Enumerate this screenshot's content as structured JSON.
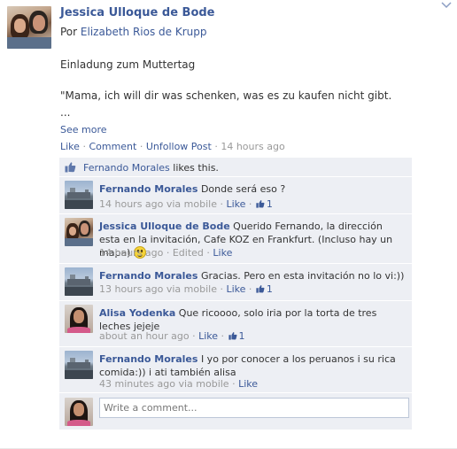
{
  "post": {
    "author": "Jessica Ulloque de Bode",
    "via_prefix": "Por",
    "via_author": "Elizabeth Rios de Krupp",
    "title": "Einladung zum Muttertag",
    "body": "\"Mama, ich will dir was schenken, was es zu kaufen nicht gibt.",
    "ellipsis": "...",
    "see_more": "See more",
    "actions": {
      "like": "Like",
      "comment": "Comment",
      "unfollow": "Unfollow Post",
      "time": "14 hours ago",
      "separator": "·"
    }
  },
  "likes": {
    "name": "Fernando Morales",
    "suffix": "likes this."
  },
  "comments": [
    {
      "author": "Fernando Morales",
      "text": "Donde será eso ?",
      "time": "14 hours ago via mobile",
      "like": "Like",
      "like_count": "1"
    },
    {
      "author": "Jessica Ulloque de Bode",
      "text": "Querido Fernando, la dirección esta en la invitación, Cafe KOZ en Frankfurt. (Incluso hay un mapa)",
      "time": "14 hours ago · Edited",
      "like": "Like",
      "like_count": ""
    },
    {
      "author": "Fernando Morales",
      "text": "Gracias. Pero en esta invitación no lo vi:))",
      "time": "13 hours ago via mobile",
      "like": "Like",
      "like_count": "1"
    },
    {
      "author": "Alisa Yodenka",
      "text": "Que ricoooo, solo iria por la torta de tres leches jejeje",
      "time": "about an hour ago",
      "like": "Like",
      "like_count": "1"
    },
    {
      "author": "Fernando Morales",
      "text": "I yo por conocer a los peruanos i su rica comida:)) i ati también alisa",
      "time": "43 minutes ago via mobile",
      "like": "Like",
      "like_count": ""
    }
  ],
  "write_comment": {
    "placeholder": "Write a comment..."
  },
  "colors": {
    "link": "#3b5998",
    "feedback_bg": "#edeff4",
    "muted": "#999999"
  }
}
